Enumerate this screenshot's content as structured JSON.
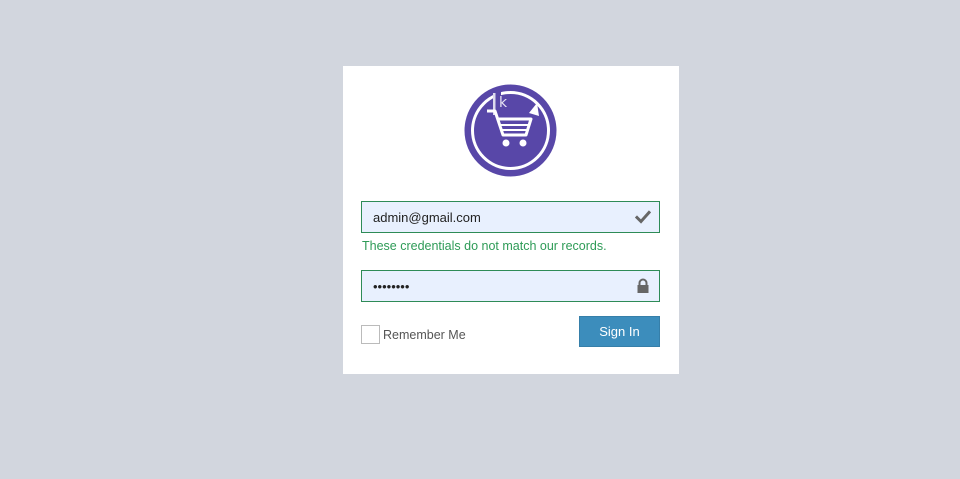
{
  "login": {
    "email_value": "admin@gmail.com",
    "error_message": "These credentials do not match our records.",
    "password_value": "••••••••",
    "remember_label": "Remember Me",
    "signin_label": "Sign In",
    "logo_letter": "k"
  },
  "icons": {
    "email": "check-icon",
    "password": "lock-icon"
  },
  "colors": {
    "page_background": "#d2d6de",
    "logo_purple": "#5847a8",
    "field_border": "#2e8b57",
    "field_background": "#e8f0fe",
    "error_text": "#2e9b57",
    "button": "#3c8dbc"
  }
}
